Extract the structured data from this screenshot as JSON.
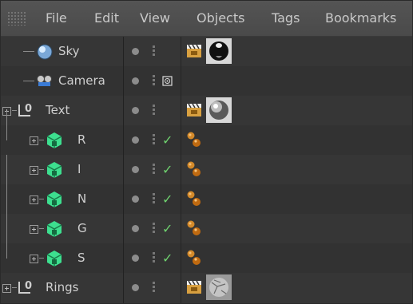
{
  "menu": {
    "items": [
      "File",
      "Edit",
      "View",
      "Objects",
      "Tags",
      "Bookmarks"
    ]
  },
  "objects": [
    {
      "name": "Sky",
      "icon": "sky-sphere-icon",
      "enabled_check": false,
      "tags": [
        "texture-clapper-icon",
        "material-black-sphere-icon"
      ]
    },
    {
      "name": "Camera",
      "icon": "camera-icon",
      "enabled_check": false,
      "tags": [
        "camera-target-tag-icon"
      ]
    },
    {
      "name": "Text",
      "icon": "null-object-icon",
      "enabled_check": false,
      "tags": [
        "texture-clapper-icon",
        "material-silver-sphere-icon"
      ]
    },
    {
      "name": "R",
      "icon": "extrude-cube-icon",
      "enabled_check": true,
      "tags": [
        "phong-tag-icon"
      ]
    },
    {
      "name": "I",
      "icon": "extrude-cube-icon",
      "enabled_check": true,
      "tags": [
        "phong-tag-icon"
      ]
    },
    {
      "name": "N",
      "icon": "extrude-cube-icon",
      "enabled_check": true,
      "tags": [
        "phong-tag-icon"
      ]
    },
    {
      "name": "G",
      "icon": "extrude-cube-icon",
      "enabled_check": true,
      "tags": [
        "phong-tag-icon"
      ]
    },
    {
      "name": "S",
      "icon": "extrude-cube-icon",
      "enabled_check": true,
      "tags": [
        "phong-tag-icon"
      ]
    },
    {
      "name": "Rings",
      "icon": "null-object-icon",
      "enabled_check": false,
      "tags": [
        "texture-clapper-icon",
        "material-cracked-sphere-icon"
      ]
    }
  ],
  "colors": {
    "panel_bg": "#363636",
    "menubar_bg": "#4e4e4e",
    "text": "#cfcfcf",
    "check": "#6fd26f",
    "cube": "#3ddf8f"
  }
}
